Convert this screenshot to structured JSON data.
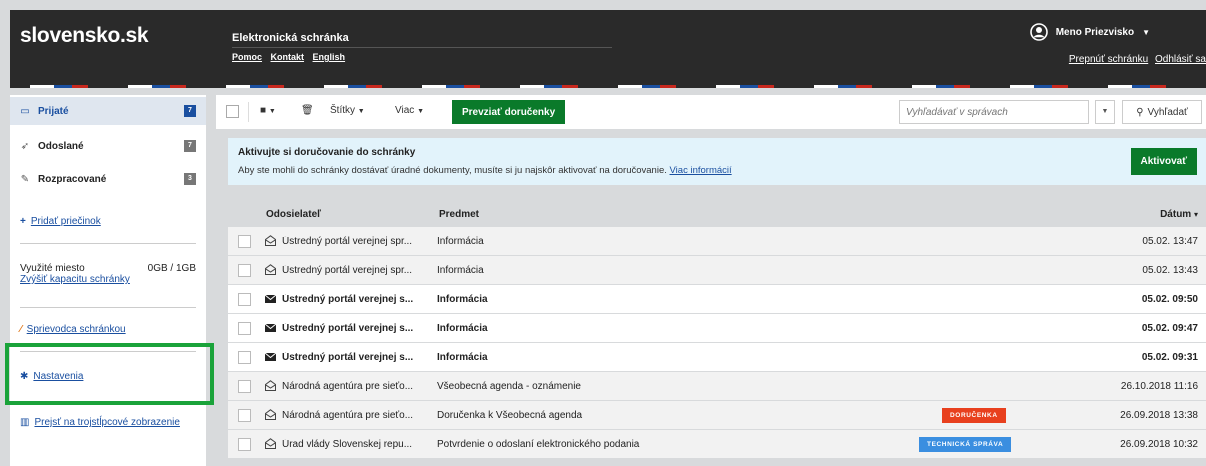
{
  "header": {
    "logo": "slovensko.sk",
    "app_title": "Elektronická schránka",
    "links": [
      "Pomoc",
      "Kontakt",
      "English"
    ],
    "user_name": "Meno Priezvisko",
    "switch_box": "Prepnúť schránku",
    "logout": "Odhlásiť sa"
  },
  "sidebar": {
    "items": [
      {
        "label": "Prijaté",
        "badge": "7",
        "icon": "inbox-icon"
      },
      {
        "label": "Odoslané",
        "badge": "7",
        "icon": "send-icon"
      },
      {
        "label": "Rozpracované",
        "badge": "3",
        "icon": "pencil-icon"
      }
    ],
    "add_folder": "Pridať priečinok",
    "storage_label": "Využité miesto",
    "storage_value": "0GB / 1GB",
    "increase_capacity": "Zvýšiť kapacitu schránky",
    "guide": "Sprievodca schránkou",
    "settings": "Nastavenia",
    "three_column": "Prejsť na trojstĺpcové zobrazenie"
  },
  "toolbar": {
    "labels_btn": "Štítky",
    "more_btn": "Viac",
    "collect_receipts": "Prevziať doručenky",
    "search_placeholder": "Vyhľadávať v správach",
    "search_btn": "Vyhľadať"
  },
  "notice": {
    "title": "Aktivujte si doručovanie do schránky",
    "text": "Aby ste mohli do schránky dostávať úradné dokumenty, musíte si ju najskôr aktivovať na doručovanie.",
    "link": "Viac informácií",
    "button": "Aktivovať"
  },
  "table": {
    "col_sender": "Odosielateľ",
    "col_subject": "Predmet",
    "col_date": "Dátum",
    "rows": [
      {
        "sender": "Ústredný portál verejnej spr...",
        "subject": "Informácia",
        "date": "05.02. 13:47",
        "unread": false,
        "tag": ""
      },
      {
        "sender": "Ústredný portál verejnej spr...",
        "subject": "Informácia",
        "date": "05.02. 13:43",
        "unread": false,
        "tag": ""
      },
      {
        "sender": "Ústredný portál verejnej s...",
        "subject": "Informácia",
        "date": "05.02. 09:50",
        "unread": true,
        "tag": ""
      },
      {
        "sender": "Ústredný portál verejnej s...",
        "subject": "Informácia",
        "date": "05.02. 09:47",
        "unread": true,
        "tag": ""
      },
      {
        "sender": "Ústredný portál verejnej s...",
        "subject": "Informácia",
        "date": "05.02. 09:31",
        "unread": true,
        "tag": ""
      },
      {
        "sender": "Národná agentúra pre sieťo...",
        "subject": "Všeobecná agenda - oznámenie",
        "date": "26.10.2018 11:16",
        "unread": false,
        "tag": ""
      },
      {
        "sender": "Národná agentúra pre sieťo...",
        "subject": "Doručenka k Všeobecná agenda",
        "date": "26.09.2018 13:38",
        "unread": false,
        "tag": "DORUČENKA",
        "tag_color": "#e8401e"
      },
      {
        "sender": "Úrad vlády Slovenskej repu...",
        "subject": "Potvrdenie o odoslaní elektronického podania",
        "date": "26.09.2018 10:32",
        "unread": false,
        "tag": "TECHNICKÁ SPRÁVA",
        "tag_color": "#3a8ee0"
      }
    ]
  }
}
